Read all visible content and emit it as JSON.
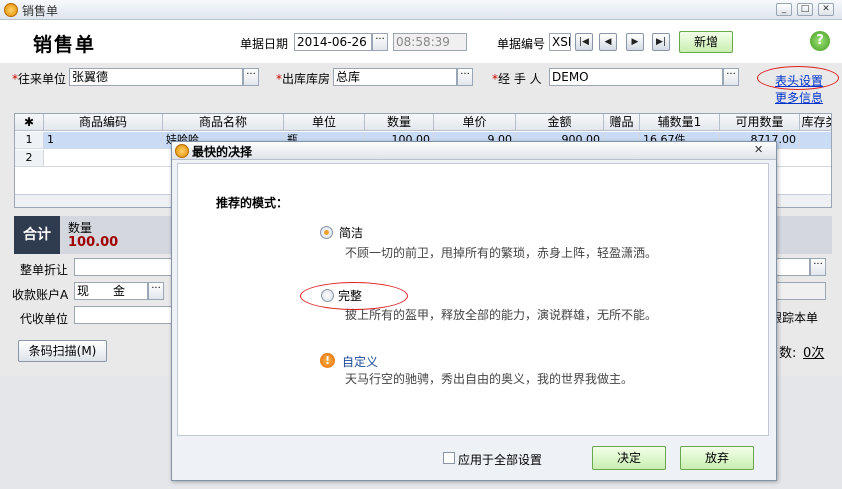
{
  "window": {
    "title": "销售单",
    "min": "_",
    "restore": "□",
    "close": "✕"
  },
  "header": {
    "doc_title": "销售单",
    "date_label": "单据日期",
    "date_value": "2014-06-26",
    "time_value": "08:58:39",
    "number_label": "单据编号",
    "number_value": "XSD",
    "new_button": "新增",
    "help": "?"
  },
  "form": {
    "customer_label": "往来单位",
    "customer_value": "张翼德",
    "warehouse_label": "出库库房",
    "warehouse_value": "总库",
    "handler_label": "经 手 人",
    "handler_value": "DEMO",
    "header_settings": "表头设置",
    "more_info": "更多信息"
  },
  "grid": {
    "columns": [
      "商品编码",
      "商品名称",
      "单位",
      "数量",
      "单价",
      "金额",
      "赠品",
      "辅数量1",
      "可用数量",
      "库存类"
    ],
    "rows": [
      {
        "no": "1",
        "code": "1",
        "name": "娃哈哈",
        "unit": "瓶",
        "qty": "100.00",
        "price": "9.00",
        "amount": "900.00",
        "aux": "16.67件",
        "avail": "8717.00"
      },
      {
        "no": "2"
      }
    ]
  },
  "summary": {
    "label": "合计",
    "qty_label": "数量",
    "qty_value": "100.00"
  },
  "bottom": {
    "discount_label": "整单折让",
    "account_label": "收款账户A",
    "account_value": "现　　金",
    "agent_label": "代收单位",
    "barcode_button": "条码扫描(M)",
    "track_label": "跟踪本单",
    "times_label": "数:",
    "times_value": "0次"
  },
  "dialog": {
    "title": "最快的决择",
    "close": "✕",
    "prompt": "推荐的模式：",
    "options": [
      {
        "label": "简洁",
        "desc": "不顾一切的前卫，甩掉所有的繁琐，赤身上阵，轻盈潇洒。",
        "selected": true
      },
      {
        "label": "完整",
        "desc": "披上所有的盔甲，释放全部的能力，演说群雄，无所不能。",
        "selected": false
      },
      {
        "label": "自定义",
        "desc": "天马行空的驰骋，秀出自由的奥义，我的世界我做主。"
      }
    ],
    "apply_all": "应用于全部设置",
    "ok": "决定",
    "cancel": "放弃"
  }
}
